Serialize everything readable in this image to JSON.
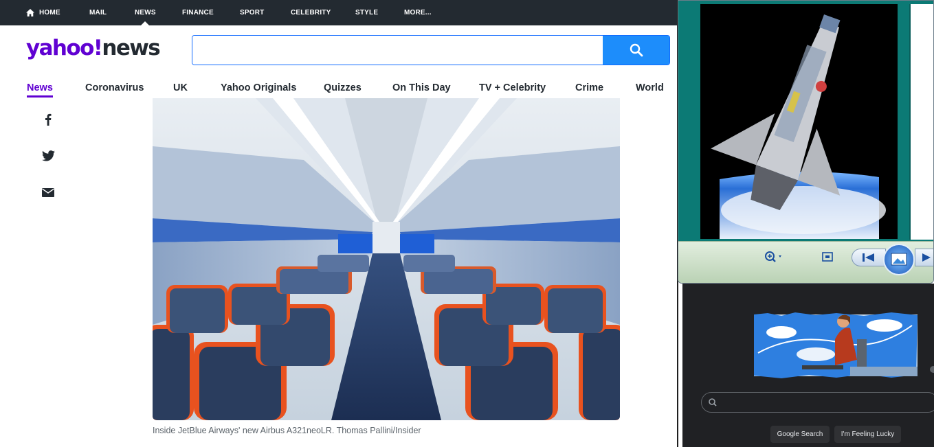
{
  "topbar": {
    "items": [
      {
        "label": "HOME"
      },
      {
        "label": "MAIL"
      },
      {
        "label": "NEWS"
      },
      {
        "label": "FINANCE"
      },
      {
        "label": "SPORT"
      },
      {
        "label": "CELEBRITY"
      },
      {
        "label": "STYLE"
      },
      {
        "label": "MORE..."
      }
    ]
  },
  "logo": {
    "part1": "yahoo!",
    "part2": "news"
  },
  "search": {
    "placeholder": "",
    "value": ""
  },
  "nav": {
    "items": [
      {
        "label": "News"
      },
      {
        "label": "Coronavirus"
      },
      {
        "label": "UK"
      },
      {
        "label": "Yahoo Originals"
      },
      {
        "label": "Quizzes"
      },
      {
        "label": "On This Day"
      },
      {
        "label": "TV + Celebrity"
      },
      {
        "label": "Crime"
      },
      {
        "label": "World"
      }
    ]
  },
  "article": {
    "caption": "Inside JetBlue Airways' new Airbus A321neoLR. Thomas Pallini/Insider"
  },
  "google": {
    "search_button": "Google Search",
    "lucky_button": "I'm Feeling Lucky"
  },
  "colors": {
    "yahoo_purple": "#6001d2",
    "yahoo_dark": "#232a31",
    "search_blue": "#1d8dfb",
    "google_bg": "#202124",
    "viewer_teal": "#0c7a75"
  },
  "icons": [
    "home-icon",
    "search-icon",
    "facebook-icon",
    "twitter-icon",
    "mail-icon",
    "zoom-icon",
    "fit-icon",
    "previous-icon",
    "slideshow-icon",
    "next-icon",
    "google-search-icon"
  ]
}
